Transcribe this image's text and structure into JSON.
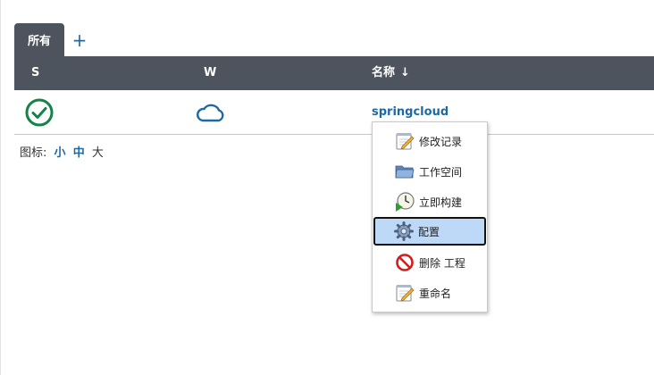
{
  "tabs": {
    "all_label": "所有",
    "add_label": "+"
  },
  "table": {
    "headers": {
      "status": "S",
      "weather": "W",
      "name": "名称",
      "sort_indicator": "↓"
    },
    "rows": [
      {
        "status_icon": "success-check-icon",
        "weather_icon": "cloud-icon",
        "name": "springcloud"
      }
    ]
  },
  "icon_legend": {
    "label": "图标:",
    "small": "小",
    "medium": "中",
    "large": "大"
  },
  "context_menu": {
    "items": [
      {
        "label": "修改记录",
        "icon": "notepad-icon"
      },
      {
        "label": "工作空间",
        "icon": "folder-icon"
      },
      {
        "label": "立即构建",
        "icon": "clock-play-icon"
      },
      {
        "label": "配置",
        "icon": "gear-icon",
        "active": true
      },
      {
        "label": "删除 工程",
        "icon": "no-entry-icon"
      },
      {
        "label": "重命名",
        "icon": "notepad-icon"
      }
    ]
  },
  "colors": {
    "header_bg": "#4d545d",
    "link": "#1b6aa5",
    "success": "#138347",
    "menu_highlight": "#bdd9f7"
  }
}
